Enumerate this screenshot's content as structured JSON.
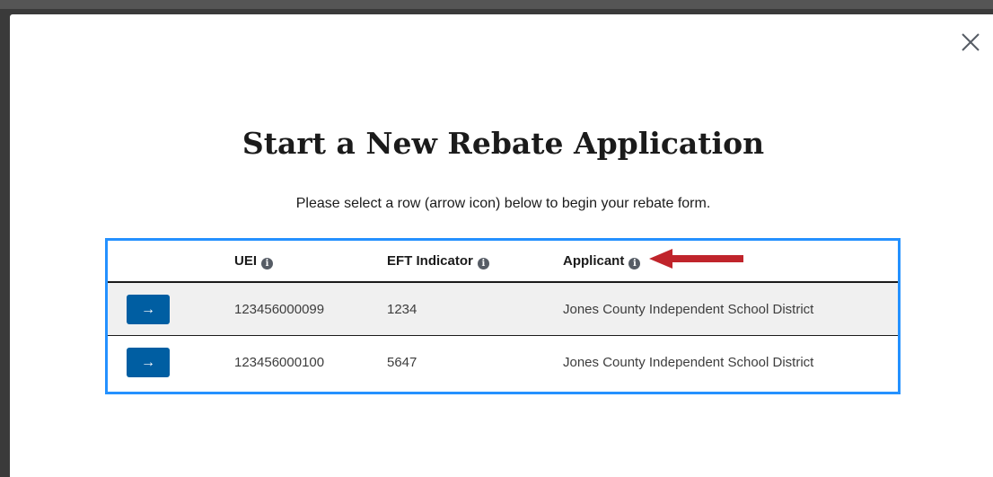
{
  "modal": {
    "title": "Start a New Rebate Application",
    "subtitle": "Please select a row (arrow icon) below to begin your rebate form.",
    "close_icon": "close-icon"
  },
  "table": {
    "headers": {
      "uei": "UEI",
      "eft": "EFT Indicator",
      "applicant": "Applicant"
    },
    "info_icon": "info-icon",
    "rows": [
      {
        "button_icon": "arrow-right-icon",
        "uei": "123456000099",
        "eft": "1234",
        "applicant": "Jones County Independent School District"
      },
      {
        "button_icon": "arrow-right-icon",
        "uei": "123456000100",
        "eft": "5647",
        "applicant": "Jones County Independent School District"
      }
    ]
  },
  "colors": {
    "table_border": "#2491ff",
    "button": "#005ea2",
    "annotation_arrow": "#c0242b"
  }
}
